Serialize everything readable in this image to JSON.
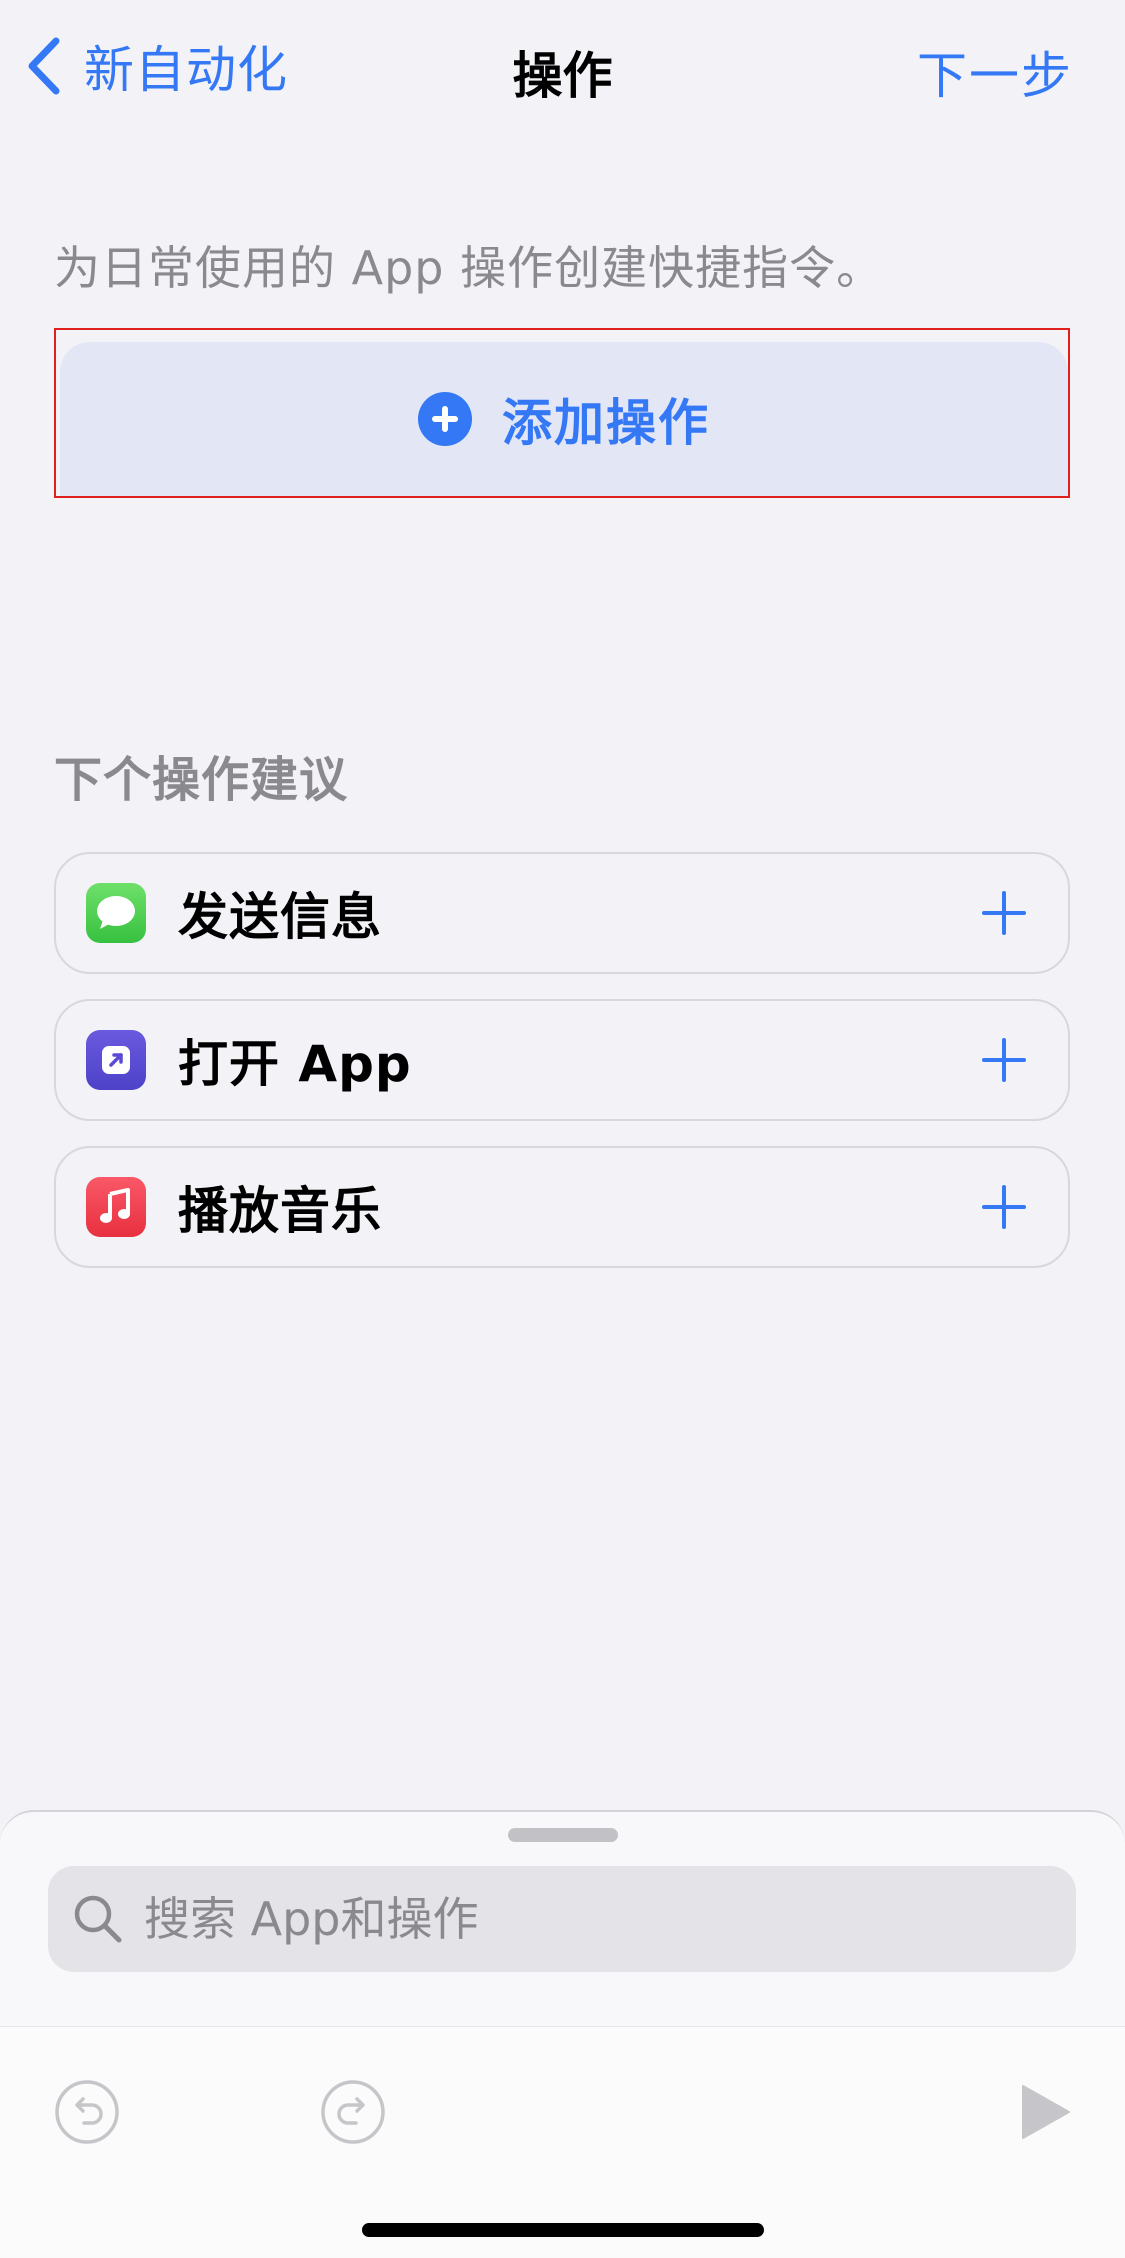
{
  "nav": {
    "back_label": "新自动化",
    "title": "操作",
    "next_label": "下一步"
  },
  "description": "为日常使用的 App 操作创建快捷指令。",
  "add_action": {
    "label": "添加操作"
  },
  "suggestions": {
    "header": "下个操作建议",
    "items": [
      {
        "label": "发送信息",
        "icon": "messages-icon"
      },
      {
        "label": "打开 App",
        "icon": "open-app-icon"
      },
      {
        "label": "播放音乐",
        "icon": "music-icon"
      }
    ]
  },
  "search": {
    "placeholder": "搜索 App和操作"
  },
  "colors": {
    "accent": "#3478f6",
    "highlight_border": "#e0201c"
  }
}
